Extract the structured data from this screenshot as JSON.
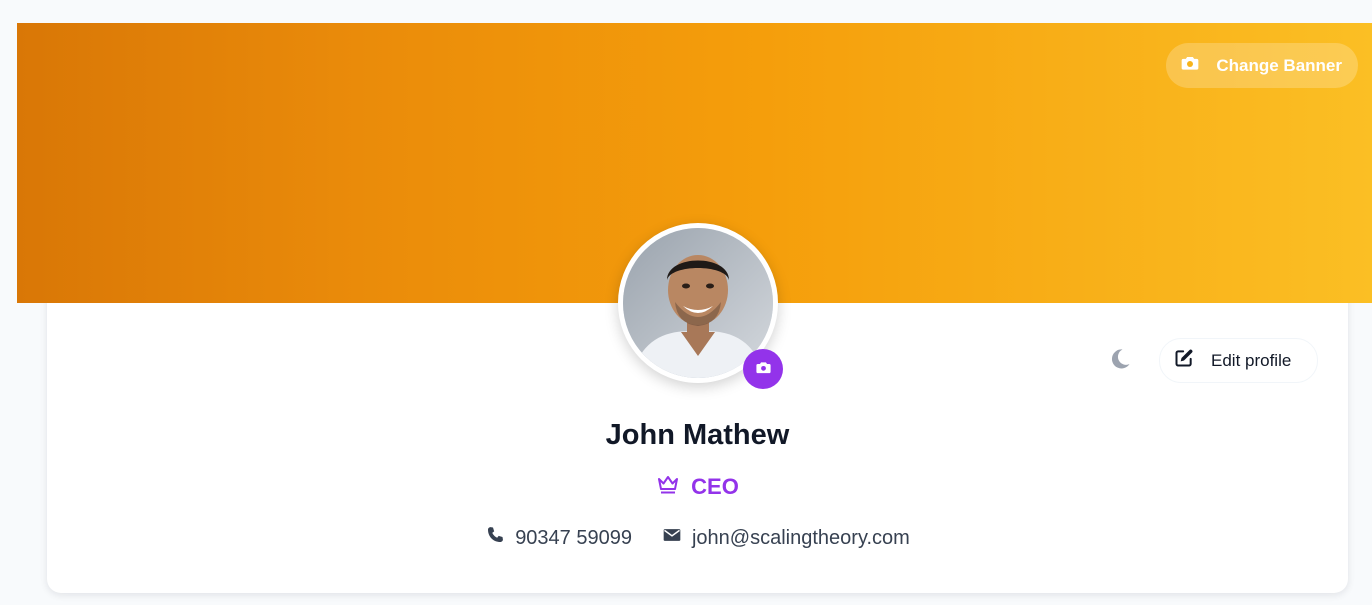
{
  "banner": {
    "change_banner_label": "Change Banner",
    "icon": "camera-icon",
    "colors": [
      "#d97706",
      "#f59e0b",
      "#fbbf24"
    ]
  },
  "avatar": {
    "alt": "John Mathew",
    "camera_icon": "camera-icon",
    "camera_color": "#9333ea"
  },
  "actions": {
    "theme_icon": "moon-icon",
    "edit_profile_label": "Edit profile",
    "edit_icon": "edit-icon"
  },
  "profile": {
    "name": "John Mathew",
    "role": "CEO",
    "role_icon": "crown-icon",
    "role_color": "#9333ea",
    "phone": "90347 59099",
    "email": "john@scalingtheory.com"
  }
}
